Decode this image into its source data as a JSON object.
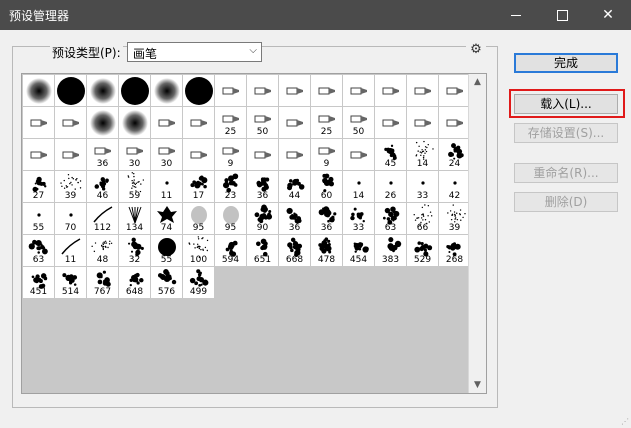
{
  "window": {
    "title": "预设管理器"
  },
  "preset_type": {
    "label": "预设类型(P):",
    "value": "画笔"
  },
  "buttons": {
    "done": "完成",
    "load": "载入(L)...",
    "save": "存储设置(S)...",
    "rename": "重命名(R)...",
    "delete": "删除(D)"
  },
  "brushes": [
    {
      "kind": "soft",
      "label": ""
    },
    {
      "kind": "hard",
      "label": ""
    },
    {
      "kind": "soft",
      "label": ""
    },
    {
      "kind": "hard",
      "label": ""
    },
    {
      "kind": "soft",
      "label": ""
    },
    {
      "kind": "hard",
      "label": ""
    },
    {
      "kind": "tool",
      "label": ""
    },
    {
      "kind": "tool",
      "label": ""
    },
    {
      "kind": "tool",
      "label": ""
    },
    {
      "kind": "tool",
      "label": ""
    },
    {
      "kind": "tool",
      "label": ""
    },
    {
      "kind": "tool",
      "label": ""
    },
    {
      "kind": "tool",
      "label": ""
    },
    {
      "kind": "tool",
      "label": ""
    },
    {
      "kind": "tool",
      "label": ""
    },
    {
      "kind": "tool",
      "label": ""
    },
    {
      "kind": "soft",
      "label": ""
    },
    {
      "kind": "soft",
      "label": ""
    },
    {
      "kind": "tool",
      "label": ""
    },
    {
      "kind": "tool",
      "label": ""
    },
    {
      "kind": "tool",
      "label": "25"
    },
    {
      "kind": "tool",
      "label": "50"
    },
    {
      "kind": "tool",
      "label": ""
    },
    {
      "kind": "tool",
      "label": "25"
    },
    {
      "kind": "tool",
      "label": "50"
    },
    {
      "kind": "tool",
      "label": ""
    },
    {
      "kind": "tool",
      "label": ""
    },
    {
      "kind": "tool",
      "label": ""
    },
    {
      "kind": "tool",
      "label": ""
    },
    {
      "kind": "tool",
      "label": ""
    },
    {
      "kind": "tool",
      "label": "36"
    },
    {
      "kind": "tool",
      "label": "30"
    },
    {
      "kind": "tool",
      "label": "30"
    },
    {
      "kind": "tool",
      "label": ""
    },
    {
      "kind": "tool",
      "label": "9"
    },
    {
      "kind": "tool",
      "label": ""
    },
    {
      "kind": "tool",
      "label": ""
    },
    {
      "kind": "tool",
      "label": "9"
    },
    {
      "kind": "tool",
      "label": ""
    },
    {
      "kind": "splat",
      "label": "45"
    },
    {
      "kind": "spray",
      "label": "14"
    },
    {
      "kind": "splat",
      "label": "24"
    },
    {
      "kind": "splat",
      "label": "27"
    },
    {
      "kind": "spray",
      "label": "39"
    },
    {
      "kind": "splat",
      "label": "46"
    },
    {
      "kind": "spray",
      "label": "59"
    },
    {
      "kind": "small",
      "label": "11"
    },
    {
      "kind": "splat",
      "label": "17"
    },
    {
      "kind": "splat",
      "label": "23"
    },
    {
      "kind": "blob",
      "label": "36"
    },
    {
      "kind": "splat",
      "label": "44"
    },
    {
      "kind": "blob",
      "label": "60"
    },
    {
      "kind": "small",
      "label": "14"
    },
    {
      "kind": "small",
      "label": "26"
    },
    {
      "kind": "small",
      "label": "33"
    },
    {
      "kind": "small",
      "label": "42"
    },
    {
      "kind": "small",
      "label": "55"
    },
    {
      "kind": "small",
      "label": "70"
    },
    {
      "kind": "stroke",
      "label": "112"
    },
    {
      "kind": "grass",
      "label": "134"
    },
    {
      "kind": "leaf",
      "label": "74"
    },
    {
      "kind": "leafsoft",
      "label": "95"
    },
    {
      "kind": "leafsoft",
      "label": "95"
    },
    {
      "kind": "blob",
      "label": "90"
    },
    {
      "kind": "splat",
      "label": "36"
    },
    {
      "kind": "splat",
      "label": "36"
    },
    {
      "kind": "splat",
      "label": "33"
    },
    {
      "kind": "splat",
      "label": "63"
    },
    {
      "kind": "spray",
      "label": "66"
    },
    {
      "kind": "spray",
      "label": "39"
    },
    {
      "kind": "splat",
      "label": "63"
    },
    {
      "kind": "stroke",
      "label": "11"
    },
    {
      "kind": "spray",
      "label": "48"
    },
    {
      "kind": "splat",
      "label": "32"
    },
    {
      "kind": "hard",
      "label": "55"
    },
    {
      "kind": "spray",
      "label": "100"
    },
    {
      "kind": "splat",
      "label": "594"
    },
    {
      "kind": "splat",
      "label": "651"
    },
    {
      "kind": "blob",
      "label": "668"
    },
    {
      "kind": "blob",
      "label": "478"
    },
    {
      "kind": "splat",
      "label": "454"
    },
    {
      "kind": "splat",
      "label": "383"
    },
    {
      "kind": "splat",
      "label": "529"
    },
    {
      "kind": "splat",
      "label": "268"
    },
    {
      "kind": "splat",
      "label": "451"
    },
    {
      "kind": "splat",
      "label": "514"
    },
    {
      "kind": "splat",
      "label": "767"
    },
    {
      "kind": "splat",
      "label": "648"
    },
    {
      "kind": "blob",
      "label": "576"
    },
    {
      "kind": "splat",
      "label": "499"
    }
  ],
  "icons": {
    "gear": "gear-icon",
    "dropdown": "chevron-down-icon",
    "scroll_up": "arrow-up-icon",
    "scroll_down": "arrow-down-icon",
    "close": "close-icon",
    "minimize": "minimize-icon",
    "maximize": "maximize-icon"
  },
  "colors": {
    "titlebar": "#4b4b4b",
    "highlight": "#e01a1a",
    "primary_border": "#2a7ad8",
    "panel_bg": "#c8c8c8"
  }
}
